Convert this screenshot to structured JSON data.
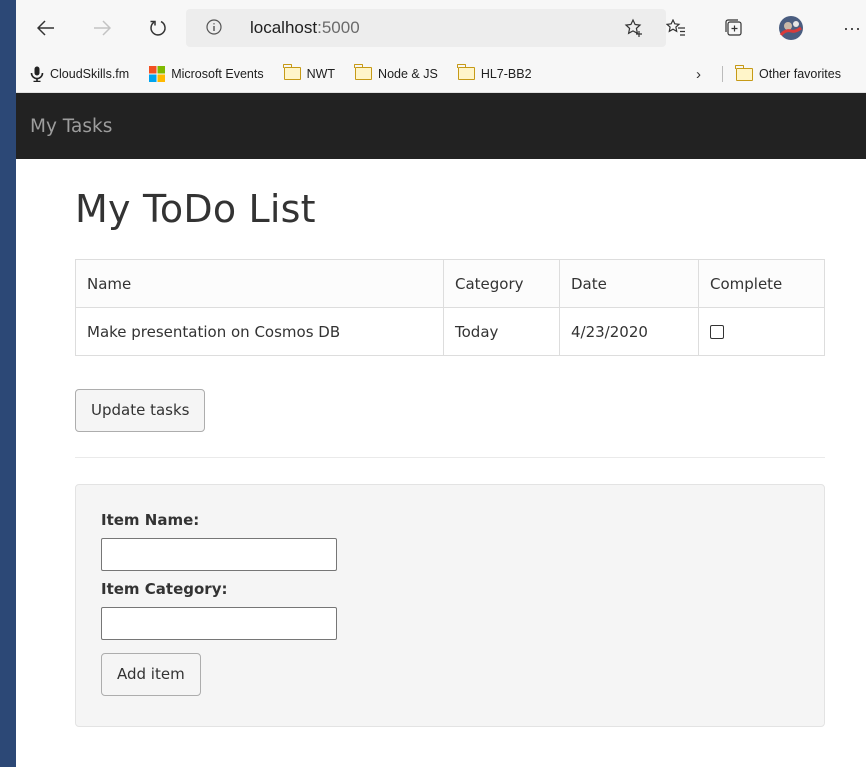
{
  "browser": {
    "url_host": "localhost",
    "url_port": ":5000",
    "favorites": [
      {
        "label": "CloudSkills.fm",
        "icon": "podcast-icon"
      },
      {
        "label": "Microsoft Events",
        "icon": "microsoft-logo-icon"
      },
      {
        "label": "NWT",
        "icon": "folder-icon"
      },
      {
        "label": "Node & JS",
        "icon": "folder-icon"
      },
      {
        "label": "HL7-BB2",
        "icon": "folder-icon"
      }
    ],
    "other_favorites": "Other favorites",
    "more_glyph": "›",
    "menu_glyph": "···"
  },
  "navbar": {
    "brand": "My Tasks"
  },
  "page": {
    "title": "My ToDo List",
    "table": {
      "headers": [
        "Name",
        "Category",
        "Date",
        "Complete"
      ],
      "rows": [
        {
          "name": "Make presentation on Cosmos DB",
          "category": "Today",
          "date": "4/23/2020",
          "complete": false
        }
      ]
    },
    "update_button": "Update tasks",
    "form": {
      "item_name_label": "Item Name:",
      "item_name_value": "",
      "item_category_label": "Item Category:",
      "item_category_value": "",
      "add_button": "Add item"
    }
  },
  "colors": {
    "desktop": "#2c4876",
    "navbar": "#222222",
    "brand_text": "#9d9d9d",
    "well": "#f5f5f5",
    "folder": "#c69a17"
  }
}
